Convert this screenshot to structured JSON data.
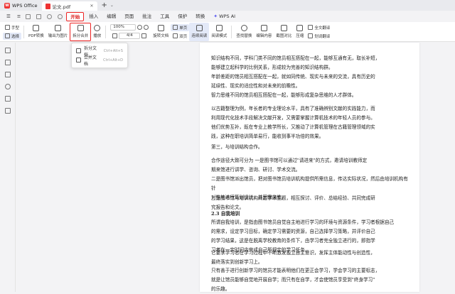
{
  "titlebar": {
    "app_name": "WPS Office",
    "doc_tab": "论文.pdf",
    "plus": "+",
    "chevron": "⌄"
  },
  "menubar": {
    "items": [
      "开始",
      "插入",
      "编辑",
      "页面",
      "批注",
      "工具",
      "保护",
      "转换"
    ],
    "ai_label": "WPS AI"
  },
  "ribbon": {
    "hand": "手型",
    "select": "选择",
    "pdf_convert": "PDF转换",
    "export_image": "输出为图片",
    "split_merge": "拆分合并",
    "play": "播放",
    "zoom_value": "100%",
    "page_value": "4/4",
    "rotate_doc": "旋转文档",
    "single_page": "单页",
    "double_page": "双页",
    "continuous_read": "连续阅读",
    "read_mode": "阅读模式",
    "find_replace": "查找替换",
    "annotate": "编辑内容",
    "screenshot": "截图对比",
    "compress": "压缩",
    "translate_full": "全文翻译",
    "translate_word": "划词翻译"
  },
  "dropdown": {
    "items": [
      {
        "label": "拆分文档",
        "shortcut": "Ctrl+Alt+S"
      },
      {
        "label": "合并文档",
        "shortcut": "Ctrl+Alt+D"
      }
    ]
  },
  "document": {
    "paragraphs": [
      "知识结构不同，学科门类不同的馆员相互搭配在一起，能够互通有无，取长补短，\n能够建立起科学的比例关系，形成较为完善的知识结构群。",
      "年龄差距的馆员相互搭配在一起，就如同传统、现实与未来的交流，具有历史的\n延续性、现实的适应性和对未来的前瞻性。",
      "智力思维不同的馆员相互搭配在一起，能够形成复杂思维的人才群体。",
      "以古籍整理为例，年长者的专业理论水平，具有了准确辨别文献的实践能力，而\n利用现代化技术手段解决文献开发，又需要掌握计算机技术的年轻人员的参与。\n他们优势互补，既在专业上教学所长，又推动了计算机管理在古籍管理领域的实\n践，这种在职培训简单易行，能收到事半功倍的效果。",
      "第三，与培训结构合作。",
      "合作途径大致可分为 一是图书馆可以通过\"请进来\"的方式，邀请培训教师定\n期来馆进行讲学、咨询、研讨、学术交流。",
      "二是图书馆派出馆员，把对图书馆员培训机构提供所需信息，传达实际状况，然后由培训机构有针\n对性地进行策划设计，并因需施教。",
      "三是图书馆与培训机构商定学术主题，相互探讨、评价、总结经验、共同完成研\n究报告和论文。",
      "2.3 自我培训",
      "所谓自我培训，是指由图书馆员自觉自主地进行学习的环境与资源条件，学习者根据自己\n的需求，设定学习目标，确定学习需要的资源，自己选择学习策略，并评价自己\n的学习结果，这是在脱离学校教育的条件下，由学习者完全独立进行的，即指学\n习者在一定时间内完成自己所规定的学习任务。",
      "它要求学习者在学习过程中不断激发独立自主意识，发挥主体能动性与创造性，\n最终落实到创新学习上。",
      "只有善于进行创新学习的馆员才能表明他们在更正会学习，学会学习的主要标志，\n就是让馆员能够自觉地开展自学；而只有在自学，才会使馆员享受到\"终身学习\"\n的乐趣。"
    ]
  }
}
